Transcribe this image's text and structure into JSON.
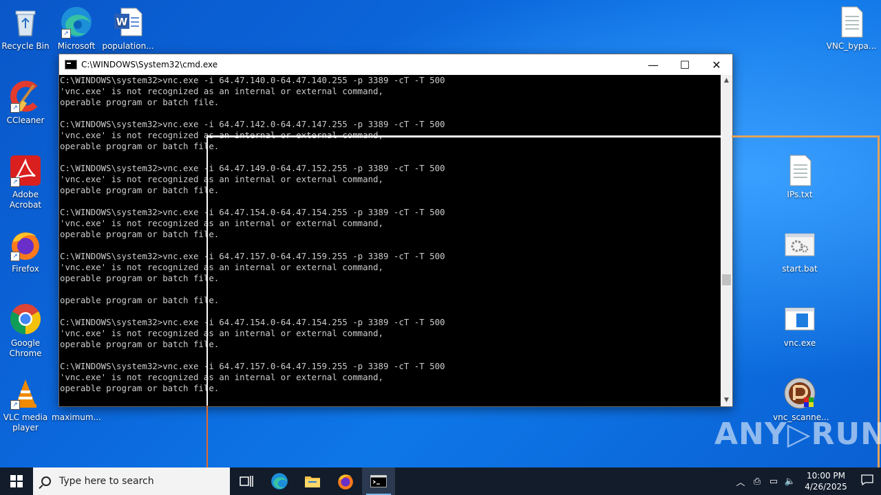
{
  "desktop": {
    "icons_left": [
      {
        "label": "Recycle Bin",
        "icon": "recycle-bin-icon"
      },
      {
        "label": "Microsoft Edge",
        "icon": "edge-icon"
      },
      {
        "label": "population...",
        "icon": "word-doc-icon"
      },
      {
        "label": "CCleaner",
        "icon": "ccleaner-icon"
      },
      {
        "label": "Adobe Acrobat",
        "icon": "acrobat-icon"
      },
      {
        "label": "Firefox",
        "icon": "firefox-icon"
      },
      {
        "label": "Google Chrome",
        "icon": "chrome-icon"
      },
      {
        "label": "VLC media player",
        "icon": "vlc-icon"
      },
      {
        "label": "maximum...",
        "icon": "file-icon"
      }
    ],
    "icons_right": [
      {
        "label": "VNC_bypa...",
        "icon": "text-file-icon"
      },
      {
        "label": "IPs.txt",
        "icon": "text-file-icon"
      },
      {
        "label": "start.bat",
        "icon": "batch-file-icon"
      },
      {
        "label": "vnc.exe",
        "icon": "exe-window-icon"
      },
      {
        "label": "vnc_scanne...",
        "icon": "scanner-app-icon"
      }
    ]
  },
  "cmd": {
    "title": "C:\\WINDOWS\\System32\\cmd.exe",
    "controls": {
      "minimize": "—",
      "maximize": "☐",
      "close": "✕"
    },
    "lines": [
      "C:\\WINDOWS\\system32>vnc.exe -i 64.47.140.0-64.47.140.255 -p 3389 -cT -T 500",
      "'vnc.exe' is not recognized as an internal or external command,",
      "operable program or batch file.",
      "",
      "C:\\WINDOWS\\system32>vnc.exe -i 64.47.142.0-64.47.147.255 -p 3389 -cT -T 500",
      "'vnc.exe' is not recognized as an internal or external command,",
      "operable program or batch file.",
      "",
      "C:\\WINDOWS\\system32>vnc.exe -i 64.47.149.0-64.47.152.255 -p 3389 -cT -T 500",
      "'vnc.exe' is not recognized as an internal or external command,",
      "operable program or batch file.",
      "",
      "C:\\WINDOWS\\system32>vnc.exe -i 64.47.154.0-64.47.154.255 -p 3389 -cT -T 500",
      "'vnc.exe' is not recognized as an internal or external command,",
      "operable program or batch file.",
      "",
      "C:\\WINDOWS\\system32>vnc.exe -i 64.47.157.0-64.47.159.255 -p 3389 -cT -T 500",
      "'vnc.exe' is not recognized as an internal or external command,",
      "operable program or batch file.",
      "",
      "operable program or batch file.",
      "",
      "C:\\WINDOWS\\system32>vnc.exe -i 64.47.154.0-64.47.154.255 -p 3389 -cT -T 500",
      "'vnc.exe' is not recognized as an internal or external command,",
      "operable program or batch file.",
      "",
      "C:\\WINDOWS\\system32>vnc.exe -i 64.47.157.0-64.47.159.255 -p 3389 -cT -T 500",
      "'vnc.exe' is not recognized as an internal or external command,",
      "operable program or batch file."
    ]
  },
  "taskbar": {
    "search_placeholder": "Type here to search",
    "clock_time": "10:00 PM",
    "clock_date": "4/26/2025"
  },
  "watermark": "ANY▷RUN",
  "colors": {
    "console_bg": "#000000",
    "console_fg": "#cccccc",
    "taskbar_bg": "#121c2b",
    "accent": "#76b9ed"
  }
}
